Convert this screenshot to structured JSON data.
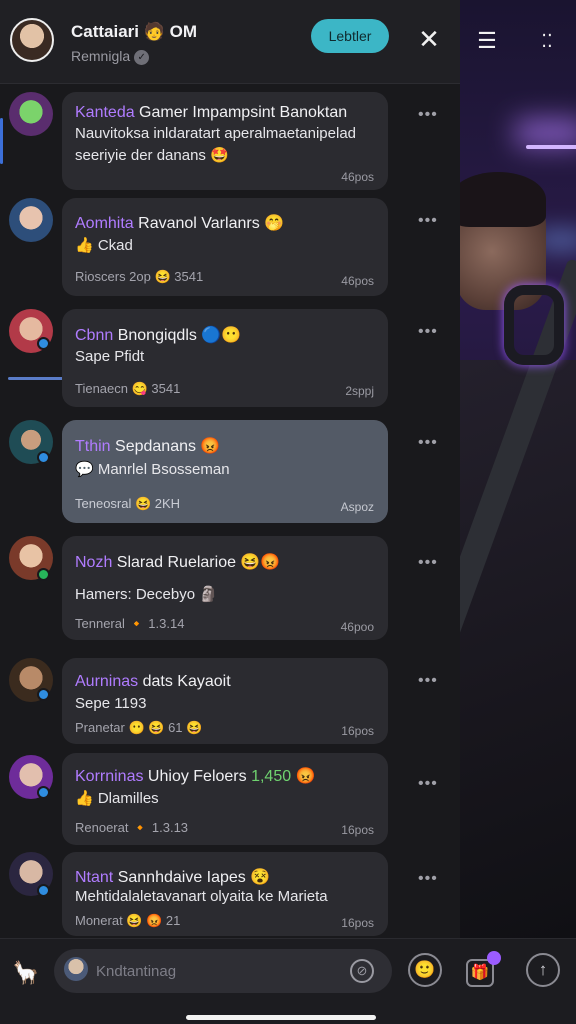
{
  "header": {
    "title": "Cattaiari 🧑 OM",
    "subtitle": "Remnigla",
    "check": "✓",
    "action_label": "Lebtler",
    "close": "✕"
  },
  "toolbar": {
    "filter": "☰",
    "grid": "⁚⁚"
  },
  "messages": [
    {
      "nick": "Kanteda",
      "rest": " Gamer Impampsint Banoktan",
      "line1": "Nauvitoksa inldaratart aperalmaetanipelad",
      "line2": "seeriyie der danans 🤩",
      "meta": "",
      "time": "46pos",
      "active": false
    },
    {
      "nick": "Aomhita",
      "rest": " Ravanol Varlanrs 🤭",
      "line1": "👍 Ckad",
      "meta": "Rioscers 2op 😆 3541",
      "time": "46pos",
      "active": false
    },
    {
      "nick": "Cbnn",
      "rest": " Bnongiqdls 🔵😶",
      "line1": "Sape Pfidt",
      "meta": "Tienaecn 😋 3541",
      "time": "2sppj",
      "active": false
    },
    {
      "nick": "Tthin",
      "rest": " Sepdanans 😡",
      "line1": "💬 Manrlel Bsosseman",
      "meta": "Teneosral 😆 2KH",
      "time": "Aspoz",
      "active": true
    },
    {
      "nick": "Nozh",
      "rest": " Slarad Ruelarioe 😆😡",
      "line1": "Hamers: Decebyo 🗿",
      "meta": "Tenneral 🔸 1.3.14",
      "time": "46poo",
      "active": false
    },
    {
      "nick": "Aurninas",
      "rest": " dats Kayaoit",
      "line1": "Sepe 1193",
      "meta": "Pranetar 😶 😆 61 😆",
      "time": "16pos",
      "active": false
    },
    {
      "nick": "Korrninas",
      "rest": " Uhioy Feloers ",
      "price": "1,450",
      "rest2": " 😡",
      "line1": "👍 Dlamilles",
      "meta": "Renoerat 🔸 1.3.13",
      "time": "16pos",
      "active": false
    },
    {
      "nick": "Ntant",
      "rest": " Sannhdaive Iapes 😵",
      "line1": "Mehtidalaletavanart olyaita ke Marieta",
      "meta": "Monerat 😆 😡 21",
      "time": "16pos",
      "active": false
    }
  ],
  "more": "•••",
  "bottom": {
    "placeholder": "Kndtantinag",
    "attach": "⊘",
    "sticker": "🙂",
    "gift": "🎁",
    "send": "↑"
  }
}
